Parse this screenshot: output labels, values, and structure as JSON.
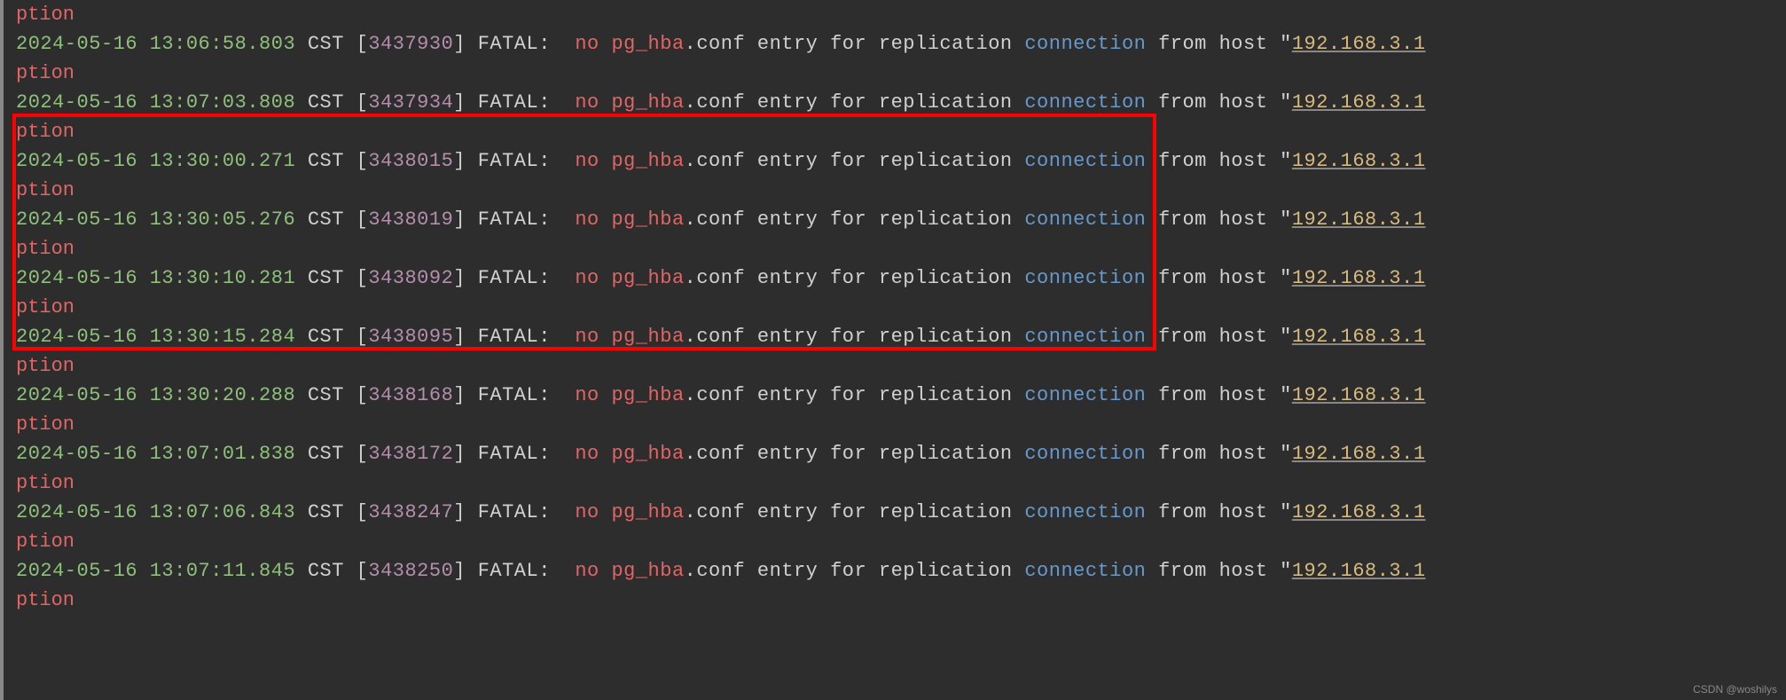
{
  "colors": {
    "timestamp": "#8ec07c",
    "pid": "#b48ead",
    "error": "#e06666",
    "connection": "#6699cc",
    "ip": "#d7ba7d"
  },
  "common": {
    "cst": "CST",
    "fatal": "FATAL:",
    "no": "no",
    "pghba": "pg_hba",
    "conf_entry": ".conf entry",
    "for_repl": "for replication",
    "connection": "connection",
    "from_host": "from host",
    "ip": "192.168.3.1",
    "wrap": "ption",
    "wrap_partial": "ption"
  },
  "logs": [
    {
      "ts": "2024-05-16 13:06:58.803",
      "pid": "3437930"
    },
    {
      "ts": "2024-05-16 13:07:03.808",
      "pid": "3437934"
    },
    {
      "ts": "2024-05-16 13:30:00.271",
      "pid": "3438015"
    },
    {
      "ts": "2024-05-16 13:30:05.276",
      "pid": "3438019"
    },
    {
      "ts": "2024-05-16 13:30:10.281",
      "pid": "3438092"
    },
    {
      "ts": "2024-05-16 13:30:15.284",
      "pid": "3438095"
    },
    {
      "ts": "2024-05-16 13:30:20.288",
      "pid": "3438168"
    },
    {
      "ts": "2024-05-16 13:07:01.838",
      "pid": "3438172"
    },
    {
      "ts": "2024-05-16 13:07:06.843",
      "pid": "3438247"
    },
    {
      "ts": "2024-05-16 13:07:11.845",
      "pid": "3438250"
    }
  ],
  "watermark": "CSDN @woshilys"
}
